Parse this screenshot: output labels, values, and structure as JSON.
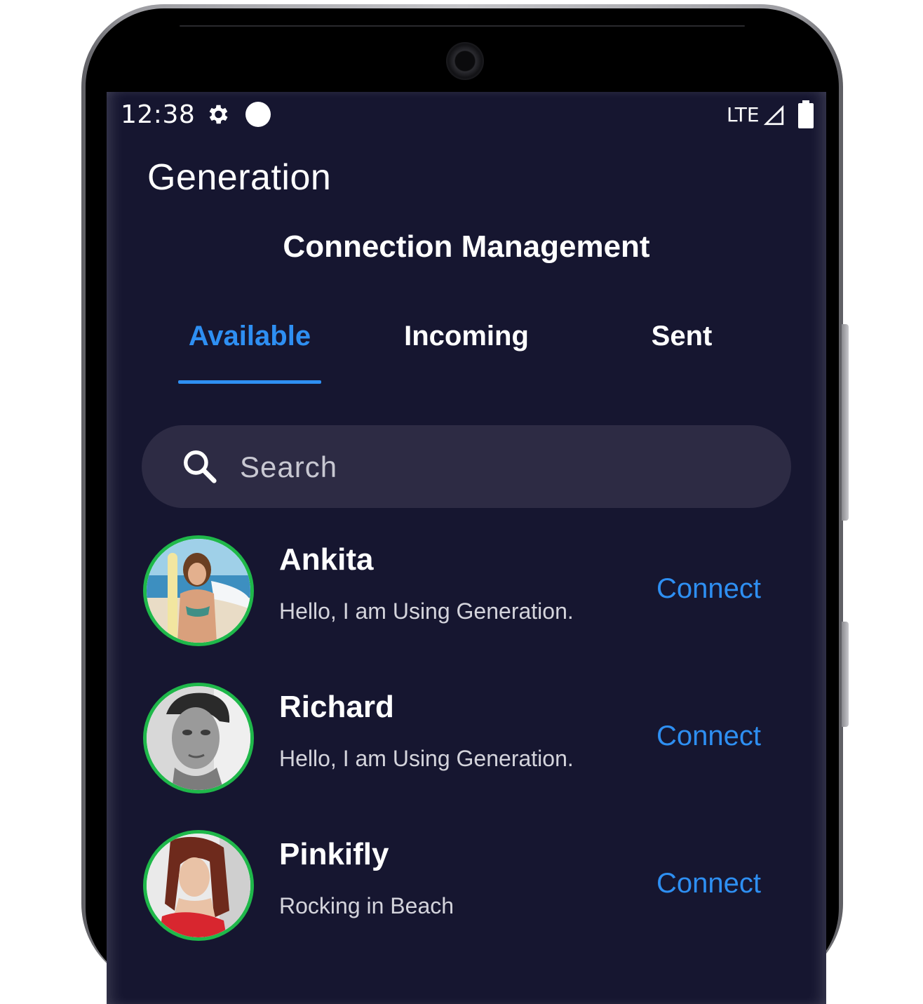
{
  "status_bar": {
    "time": "12:38",
    "network": "LTE",
    "icons": [
      "gear-icon",
      "dot-icon",
      "signal-icon",
      "battery-icon"
    ]
  },
  "app": {
    "title": "Generation",
    "heading": "Connection Management"
  },
  "tabs": [
    {
      "label": "Available",
      "active": true
    },
    {
      "label": "Incoming",
      "active": false
    },
    {
      "label": "Sent",
      "active": false
    }
  ],
  "search": {
    "placeholder": "Search",
    "value": "",
    "icon": "search-icon"
  },
  "contacts": [
    {
      "name": "Ankita",
      "status": "Hello, I am Using Generation.",
      "action": "Connect"
    },
    {
      "name": "Richard",
      "status": "Hello, I am Using Generation.",
      "action": "Connect"
    },
    {
      "name": "Pinkifly",
      "status": "Rocking in Beach",
      "action": "Connect"
    }
  ],
  "colors": {
    "background": "#161630",
    "accent": "#2e8ff2",
    "search_bg": "#2d2b44",
    "avatar_ring": "#1fb84a",
    "text": "#ffffff"
  }
}
